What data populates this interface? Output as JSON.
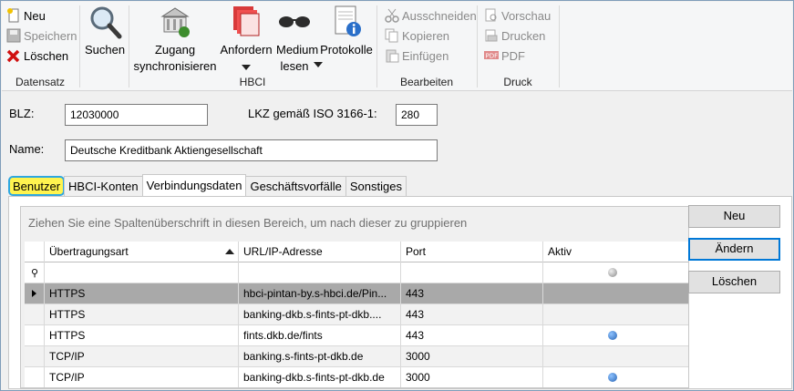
{
  "ribbon": {
    "datensatz": {
      "label": "Datensatz",
      "neu": "Neu",
      "speichern": "Speichern",
      "loeschen": "Löschen"
    },
    "suchen": {
      "label": "Suchen"
    },
    "hbci": {
      "label": "HBCI",
      "zugang": "Zugang synchronisieren",
      "anfordern": "Anfordern",
      "medium": "Medium lesen",
      "protokolle": "Protokolle"
    },
    "bearbeiten": {
      "label": "Bearbeiten",
      "ausschneiden": "Ausschneiden",
      "kopieren": "Kopieren",
      "einfuegen": "Einfügen"
    },
    "druck": {
      "label": "Druck",
      "vorschau": "Vorschau",
      "drucken": "Drucken",
      "pdf": "PDF"
    }
  },
  "form": {
    "blz_label": "BLZ:",
    "blz_value": "12030000",
    "lkz_label": "LKZ gemäß ISO 3166-1:",
    "lkz_value": "280",
    "name_label": "Name:",
    "name_value": "Deutsche Kreditbank Aktiengesellschaft"
  },
  "tabs": [
    "Benutzer",
    "HBCI-Konten",
    "Verbindungsdaten",
    "Geschäftsvorfälle",
    "Sonstiges"
  ],
  "active_tab": "Verbindungsdaten",
  "highlight_color": "#fff44f",
  "grid": {
    "group_hint": "Ziehen Sie eine Spaltenüberschrift in diesen Bereich, um nach dieser zu gruppieren",
    "columns": [
      "Übertragungsart",
      "URL/IP-Adresse",
      "Port",
      "Aktiv"
    ],
    "rows": [
      {
        "art": "HTTPS",
        "url": "hbci-pintan-by.s-hbci.de/Pin...",
        "port": "443",
        "aktiv": false
      },
      {
        "art": "HTTPS",
        "url": "banking-dkb.s-fints-pt-dkb....",
        "port": "443",
        "aktiv": false
      },
      {
        "art": "HTTPS",
        "url": "fints.dkb.de/fints",
        "port": "443",
        "aktiv": true
      },
      {
        "art": "TCP/IP",
        "url": "banking.s-fints-pt-dkb.de",
        "port": "3000",
        "aktiv": false
      },
      {
        "art": "TCP/IP",
        "url": "banking-dkb.s-fints-pt-dkb.de",
        "port": "3000",
        "aktiv": true
      }
    ]
  },
  "buttons": {
    "neu": "Neu",
    "aendern": "Ändern",
    "loeschen": "Löschen"
  }
}
